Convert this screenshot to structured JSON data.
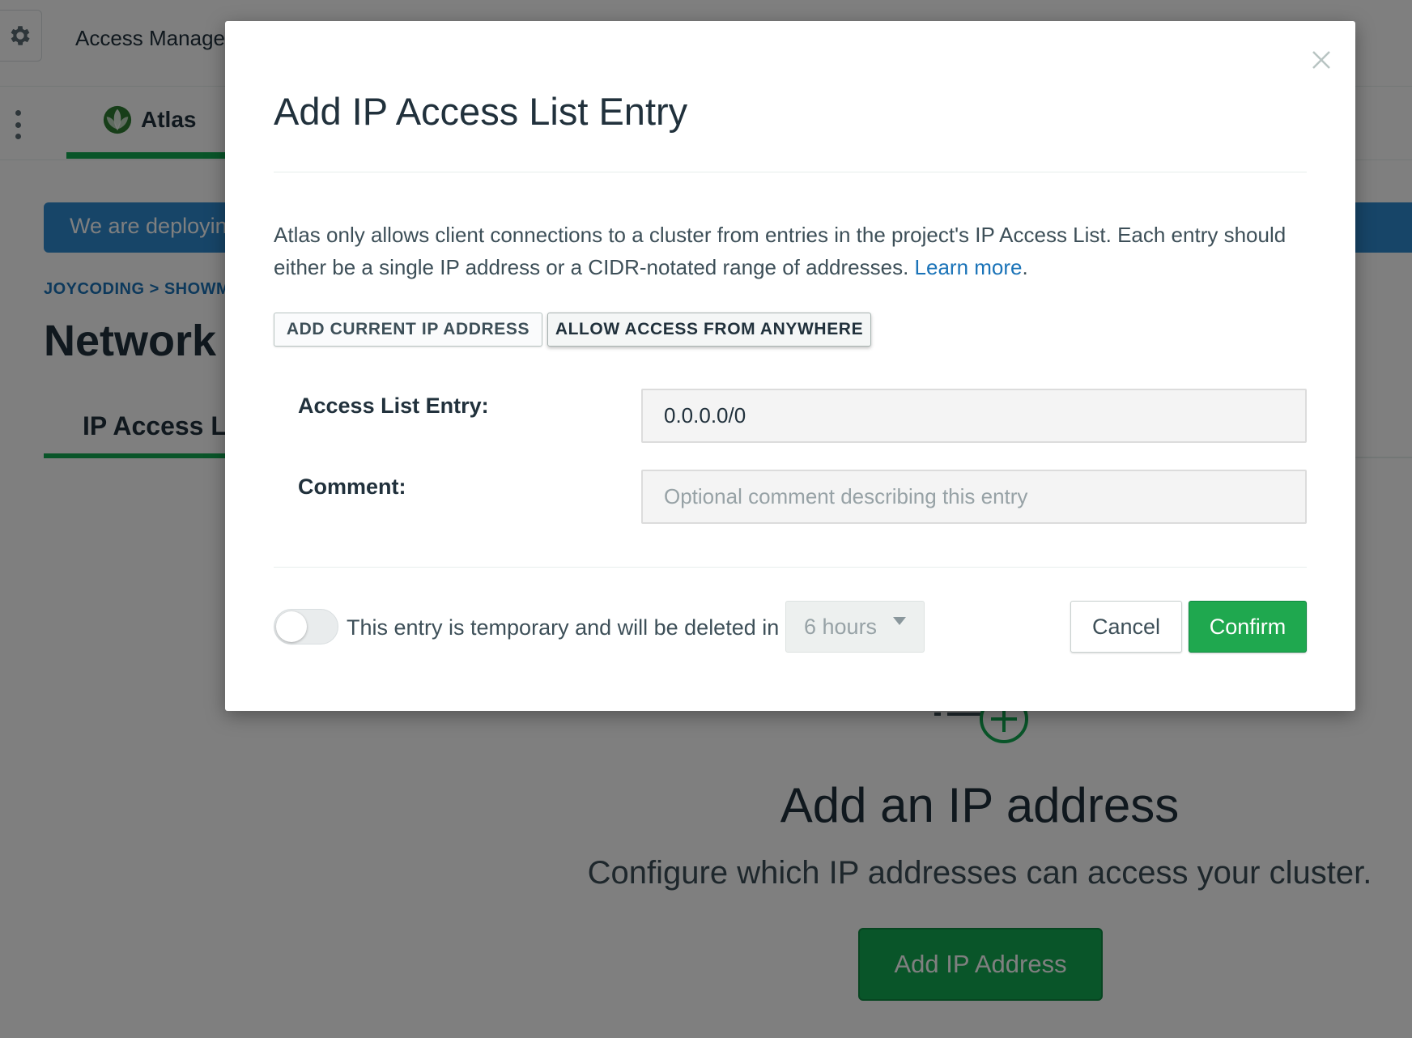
{
  "header": {
    "title": "Access Manager",
    "settings_icon": "gear-icon"
  },
  "navbar": {
    "product_label": "Atlas",
    "menu_icon": "kebab-icon",
    "logo_icon": "atlas-leaf-icon",
    "accent_color": "#13aa52"
  },
  "banner": {
    "text": "We are deploying your changes"
  },
  "breadcrumb": {
    "text": "JOYCODING > SHOWME"
  },
  "page": {
    "title": "Network Access",
    "tab_label": "IP Access List"
  },
  "empty_state": {
    "title": "Add an IP address",
    "subtitle": "Configure which IP addresses can access your cluster.",
    "button_label": "Add IP Address"
  },
  "modal": {
    "title": "Add IP Access List Entry",
    "description": "Atlas only allows client connections to a cluster from entries in the project's IP Access List. Each entry should either be a single IP address or a CIDR-notated range of addresses.",
    "learn_more": "Learn more",
    "period": ".",
    "add_current_ip_label": "ADD CURRENT IP ADDRESS",
    "allow_anywhere_label": "ALLOW ACCESS FROM ANYWHERE",
    "entry_label": "Access List Entry:",
    "entry_value": "0.0.0.0/0",
    "comment_label": "Comment:",
    "comment_placeholder": "Optional comment describing this entry",
    "temporary_text": "This entry is temporary and will be deleted in",
    "duration_selected": "6 hours",
    "temporary_enabled": false,
    "cancel_label": "Cancel",
    "confirm_label": "Confirm",
    "confirm_color": "#1fa84f",
    "link_color": "#1a73b8"
  }
}
